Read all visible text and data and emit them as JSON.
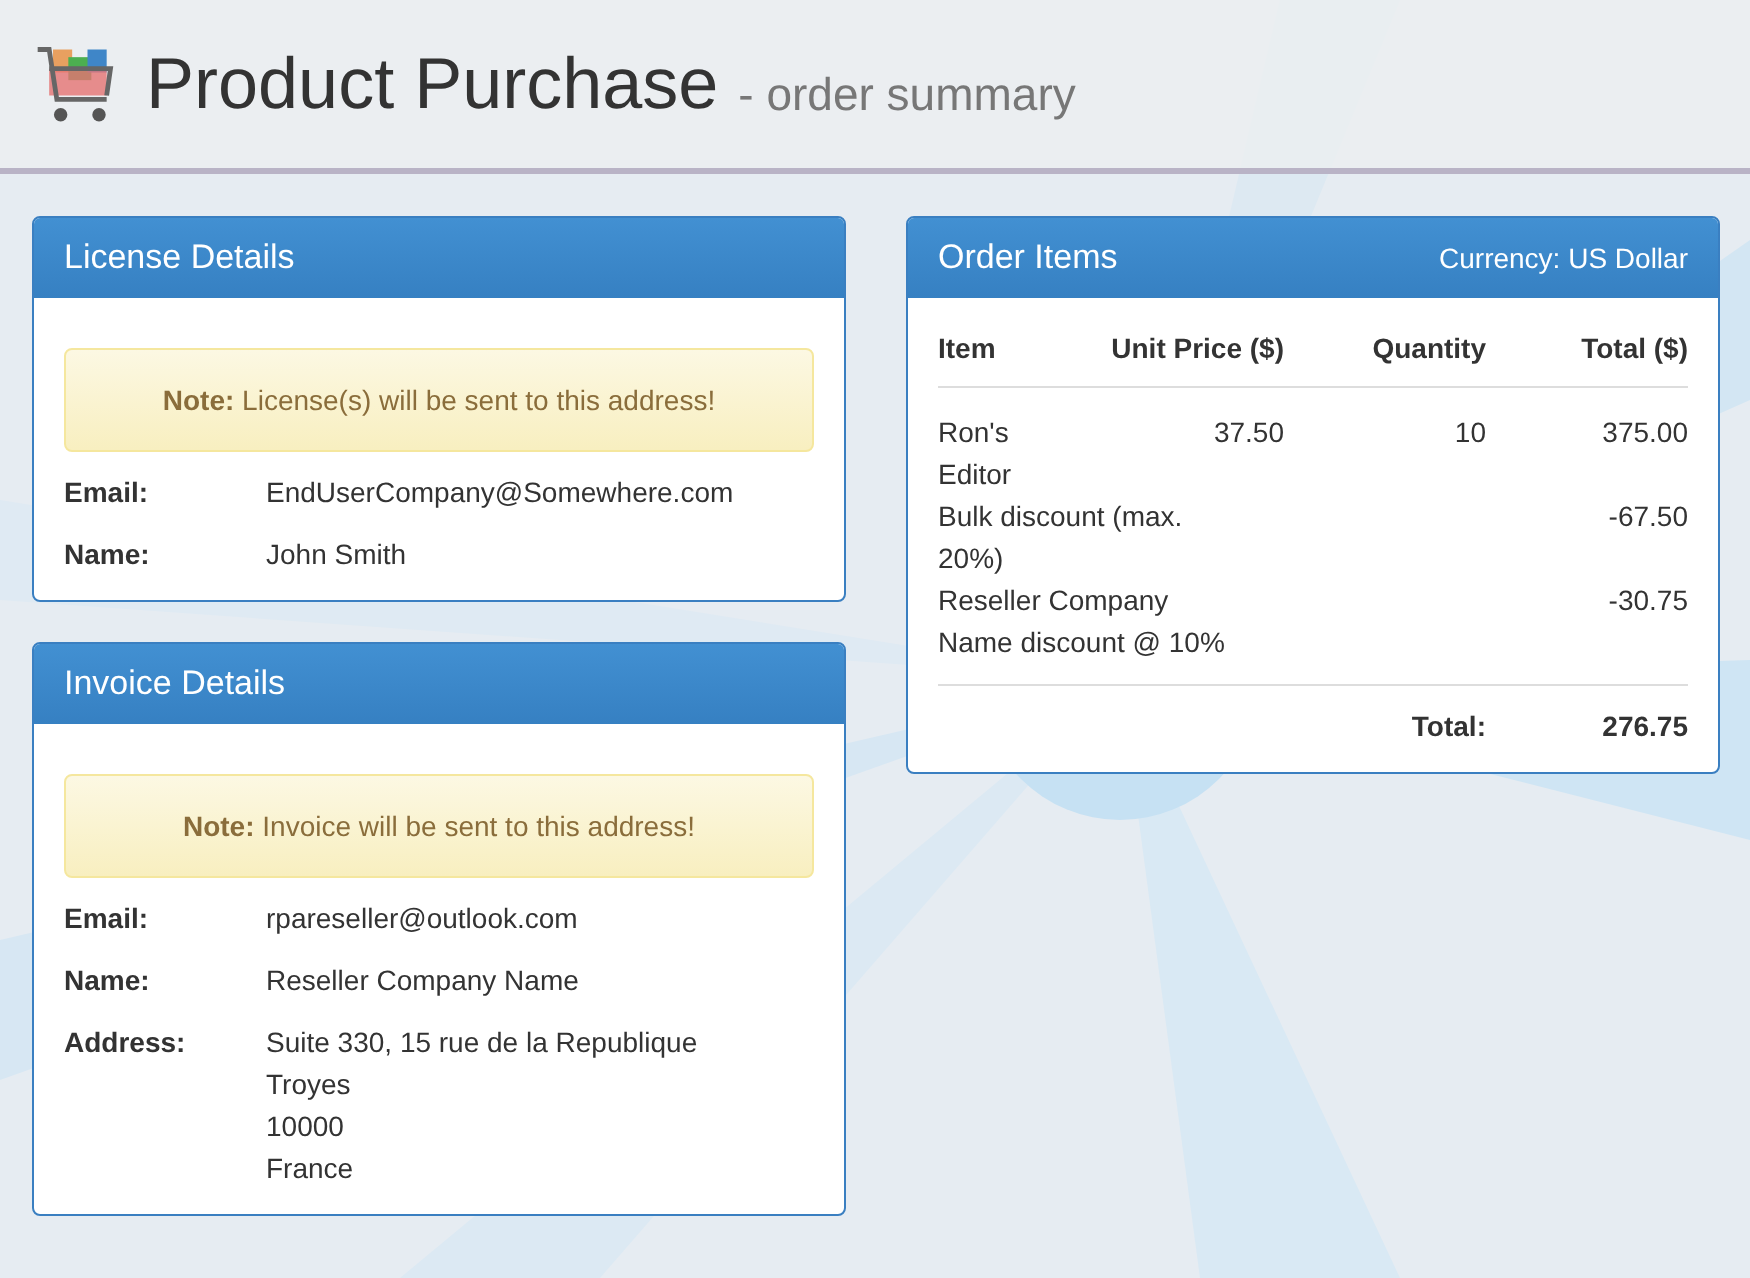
{
  "header": {
    "title": "Product Purchase",
    "subtitle": "- order summary"
  },
  "license": {
    "title": "License Details",
    "note": "**Note:** License(s) will be sent to this address!",
    "fields": [
      {
        "label": "Email:",
        "lines": [
          "EndUserCompany@Somewhere.com"
        ]
      },
      {
        "label": "Name:",
        "lines": [
          "John Smith"
        ]
      }
    ]
  },
  "invoice": {
    "title": "Invoice Details",
    "note": "**Note:** Invoice will be sent to this address!",
    "fields": [
      {
        "label": "Email:",
        "lines": [
          "rpareseller@outlook.com"
        ]
      },
      {
        "label": "Name:",
        "lines": [
          "Reseller Company Name"
        ]
      },
      {
        "label": "Address:",
        "lines": [
          "Suite 330, 15 rue de la Republique",
          "Troyes",
          "10000",
          "France"
        ]
      }
    ]
  },
  "order": {
    "title": "Order Items",
    "currency": "Currency: US Dollar",
    "columns": [
      "Item",
      "Unit Price ($)",
      "Quantity",
      "Total ($)"
    ],
    "rows": [
      {
        "kind": "item",
        "item": "Ron's Editor",
        "unit_price": "37.50",
        "quantity": "10",
        "total": "375.00"
      },
      {
        "kind": "discount",
        "item": "Bulk discount (max. 20%)",
        "total": "-67.50"
      },
      {
        "kind": "discount",
        "item": "Reseller Company Name discount @ 10%",
        "total": "-30.75"
      }
    ],
    "total_label": "Total:",
    "total_value": "276.75"
  }
}
